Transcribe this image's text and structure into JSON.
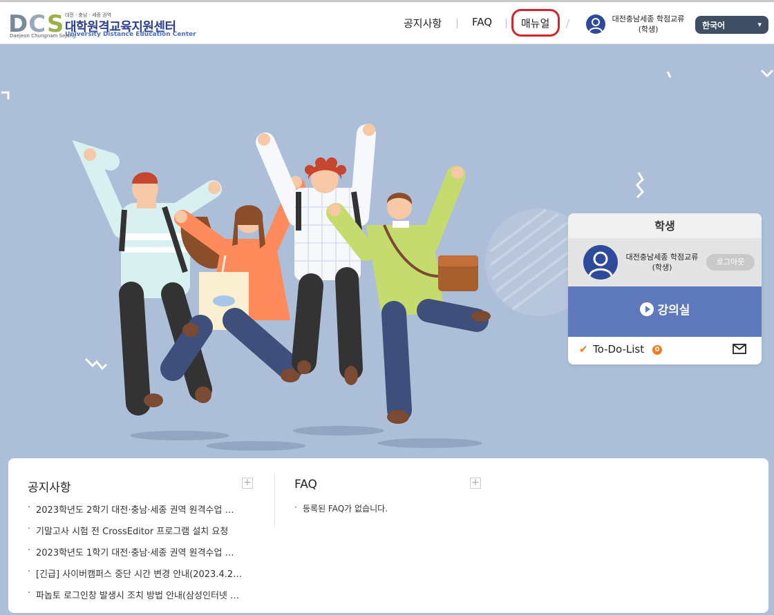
{
  "header": {
    "logo": {
      "letters": [
        "D",
        "C",
        "S"
      ],
      "region_small": "대전 · 충남 · 세종 권역",
      "sub_caption": "Daejeon Chungnam Sejong",
      "title_kr": "대학원격교육지원센터",
      "title_en": "University Distance Education Center"
    },
    "nav": {
      "notice": "공지사항",
      "faq": "FAQ",
      "manual": "매뉴얼"
    },
    "user": {
      "name": "대전충남세종 학점교류",
      "role": "(학생)"
    },
    "language": "한국어"
  },
  "panel": {
    "title": "학생",
    "user_name": "대전충남세종 학점교류",
    "user_role": "(학생)",
    "logout": "로그아웃",
    "lecture": "강의실",
    "todo_label": "To-Do-List",
    "todo_count": "0"
  },
  "notices": {
    "title": "공지사항",
    "items": [
      "2023학년도 2학기 대전·충남·세종 권역 원격수업 …",
      "기말고사 시험 전 CrossEditor 프로그램 설치 요청",
      "2023학년도 1학기 대전·충남·세종 권역 원격수업 …",
      "[긴급] 사이버캠퍼스 중단 시간 변경 안내(2023.4.2…",
      "파놉토 로그인창 발생시 조치 방법 안내(삼성인터넷 …"
    ]
  },
  "faq": {
    "title": "FAQ",
    "items": [
      "등록된 FAQ가 없습니다."
    ]
  },
  "colors": {
    "hero_bg": "#adbfd8",
    "brand_blue": "#2d4b9a",
    "lecture_blue": "#5e79bb",
    "accent_orange": "#f27a1a",
    "highlight_red": "#d6232a"
  }
}
